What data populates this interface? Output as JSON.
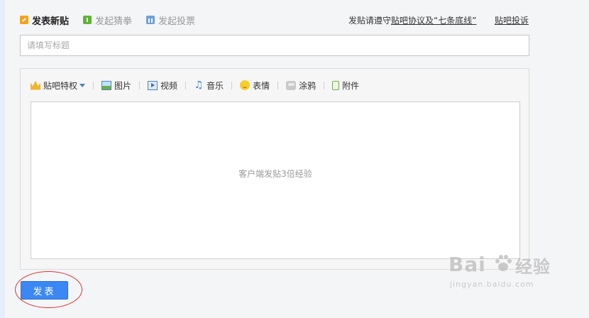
{
  "tabs": [
    {
      "label": "发表新贴",
      "icon": "edit-icon",
      "active": true
    },
    {
      "label": "发起猜拳",
      "icon": "guess-icon",
      "active": false
    },
    {
      "label": "发起投票",
      "icon": "vote-icon",
      "active": false
    }
  ],
  "rules": {
    "prefix": "发贴请遵守",
    "link": "贴吧协议及“七条底线”"
  },
  "complain_link": "贴吧投诉",
  "title_input": {
    "placeholder": "请填写标题",
    "value": ""
  },
  "toolbar": [
    {
      "label": "贴吧特权",
      "icon": "crown-icon"
    },
    {
      "label": "图片",
      "icon": "picture-icon"
    },
    {
      "label": "视频",
      "icon": "video-icon"
    },
    {
      "label": "音乐",
      "icon": "music-icon"
    },
    {
      "label": "表情",
      "icon": "emoji-icon"
    },
    {
      "label": "涂鸦",
      "icon": "doodle-icon"
    },
    {
      "label": "附件",
      "icon": "attachment-icon"
    }
  ],
  "editor_hint": "客户端发贴3倍经验",
  "submit_label": "发表",
  "watermark": {
    "brand": "Bai",
    "brand_suffix": "经验",
    "url": "jingyan.baidu.com"
  },
  "colors": {
    "submit": "#3b88f5",
    "annotation_circle": "#d23b3b"
  }
}
